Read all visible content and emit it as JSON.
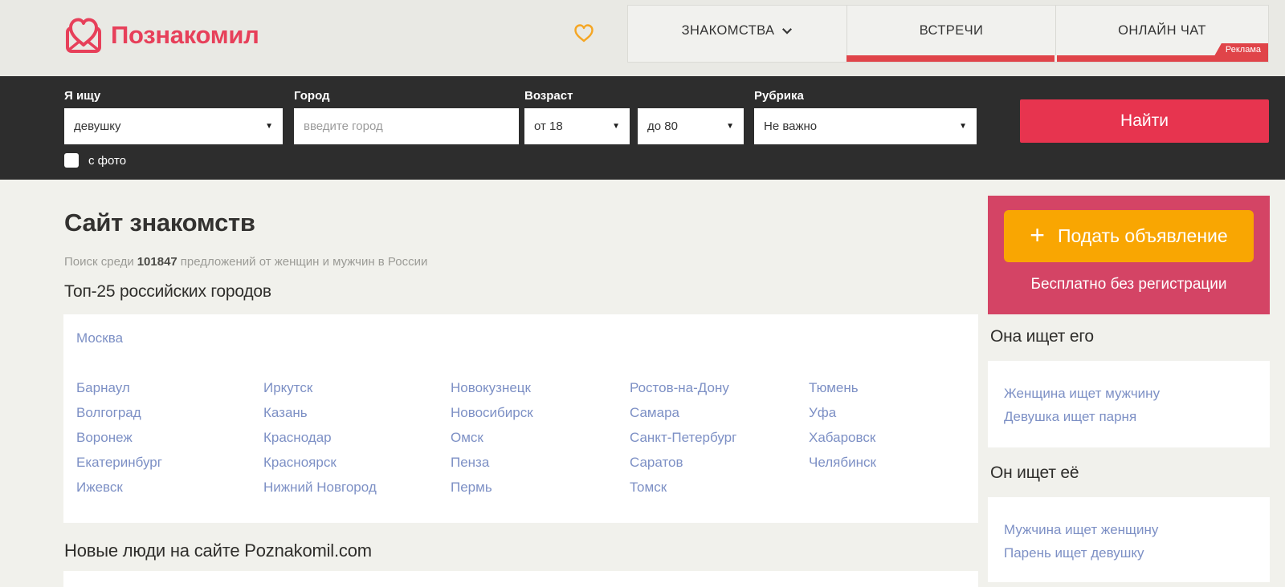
{
  "brand": {
    "name": "Познакомил"
  },
  "header": {
    "tab_dating": "ЗНАКОМСТВА",
    "tab_meetings": "ВСТРЕЧИ",
    "tab_chat": "ОНЛАЙН ЧАТ",
    "ad_badge": "Реклама"
  },
  "search": {
    "seeking_label": "Я ищу",
    "seeking_value": "девушку",
    "city_label": "Город",
    "city_placeholder": "введите город",
    "age_label": "Возраст",
    "age_from": "от 18",
    "age_to": "до 80",
    "rubric_label": "Рубрика",
    "rubric_value": "Не важно",
    "submit_label": "Найти",
    "with_photo_label": "с фото"
  },
  "main": {
    "title": "Сайт знакомств",
    "subtitle_prefix": "Поиск среди",
    "count": "101847",
    "subtitle_suffix": "предложений от женщин и мужчин в России",
    "top_cities_title": "Топ-25 российских городов",
    "featured_city": "Москва",
    "city_columns": {
      "c1": [
        "Барнаул",
        "Волгоград",
        "Воронеж",
        "Екатеринбург",
        "Ижевск"
      ],
      "c2": [
        "Иркутск",
        "Казань",
        "Краснодар",
        "Красноярск",
        "Нижний Новгород"
      ],
      "c3": [
        "Новокузнецк",
        "Новосибирск",
        "Омск",
        "Пенза",
        "Пермь"
      ],
      "c4": [
        "Ростов-на-Дону",
        "Самара",
        "Санкт-Петербург",
        "Саратов",
        "Томск"
      ],
      "c5": [
        "Тюмень",
        "Уфа",
        "Хабаровск",
        "Челябинск"
      ]
    },
    "new_people_title": "Новые люди на сайте Poznakomil.com"
  },
  "sidebar": {
    "post_ad_plus": "+",
    "post_ad_label": "Подать объявление",
    "post_ad_note": "Бесплатно без регистрации",
    "she_seeks_title": "Она ищет его",
    "she_seeks_links": [
      "Женщина ищет мужчину",
      "Девушка ищет парня"
    ],
    "he_seeks_title": "Он ищет её",
    "he_seeks_links": [
      "Мужчина ищет женщину",
      "Парень ищет девушку"
    ]
  },
  "colors": {
    "brand_red": "#e7405a",
    "accent_red": "#e04449",
    "find_button_red": "#e7344f",
    "sidebar_red": "#d44465",
    "orange": "#f9a602",
    "heart_orange": "#f5a623",
    "link_blue": "#7d90c5",
    "dark_bar": "#2d2d2d"
  }
}
